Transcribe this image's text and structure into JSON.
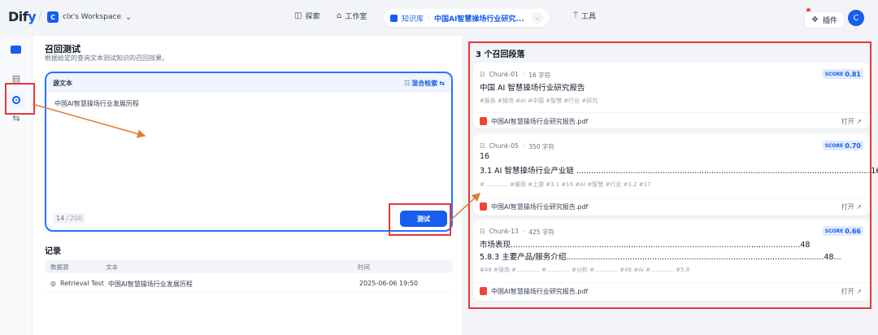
{
  "app": {
    "logo": "Dify",
    "workspace_badge": "C",
    "workspace_name": "clx's Workspace",
    "workspace_chevron": "⌄"
  },
  "nav": {
    "explore": "探索",
    "studio": "工作室",
    "knowledge": "知识库",
    "kb_name": "中国AI智慧操场行业研究...",
    "tools": "工具",
    "plugins": "插件",
    "avatar": "C"
  },
  "main": {
    "title": "召回测试",
    "subtitle": "根据给定的查询文本测试知识的召回效果。",
    "source_label": "源文本",
    "mode_label": "混合检索",
    "query_text": "中国AI智慧操场行业发展历程",
    "count": "14",
    "max": "200",
    "test_button": "测试",
    "records_title": "记录",
    "columns": [
      "数据源",
      "文本",
      "时间"
    ],
    "rows": [
      {
        "source": "Retrieval Test",
        "text": "中国AI智慧操场行业发展历程",
        "time": "2025-06-06 19:50"
      }
    ]
  },
  "results": {
    "title": "3 个召回段落",
    "score_key": "SCORE",
    "open_label": "打开",
    "chunks": [
      {
        "id": "Chunk-01",
        "chars": "16 字符",
        "score": "0.81",
        "lines": [
          "中国 AI 智慧操场行业研究报告"
        ],
        "tags": "#报告  #操场  #AI  #中国  #智慧  #行业  #研究",
        "file": "中国AI智慧操场行业研究报告.pdf"
      },
      {
        "id": "Chunk-05",
        "chars": "350 字符",
        "score": "0.70",
        "lines": [
          "16",
          "3.1 AI 智慧操场行业产业链 ........................................................................................................................16..."
        ],
        "tags": "#.............  #操场  #上游  #3.1  #16  #AI  #智慧  #行业  #3.2  #17",
        "file": "中国AI智慧操场行业研究报告.pdf"
      },
      {
        "id": "Chunk-13",
        "chars": "425 字符",
        "score": "0.66",
        "lines": [
          "市场表现......................................................................................................................48",
          "5.8.3 主要产品/服务介绍.........................................................................................................48..."
        ],
        "tags": "#48  #操场  #.............  #.............  #分析  #.............  #49  #AI  #.............  #5.8",
        "file": "中国AI智慧操场行业研究报告.pdf"
      }
    ]
  },
  "colors": {
    "accent": "#155eef",
    "annotation": "#e5383b",
    "arrow": "#e07b39"
  },
  "icons": {
    "explore": "compass-icon",
    "studio": "studio-icon",
    "knowledge": "book-icon",
    "tools": "tool-icon",
    "plugins": "plugin-icon",
    "pdf": "pdf-icon"
  }
}
